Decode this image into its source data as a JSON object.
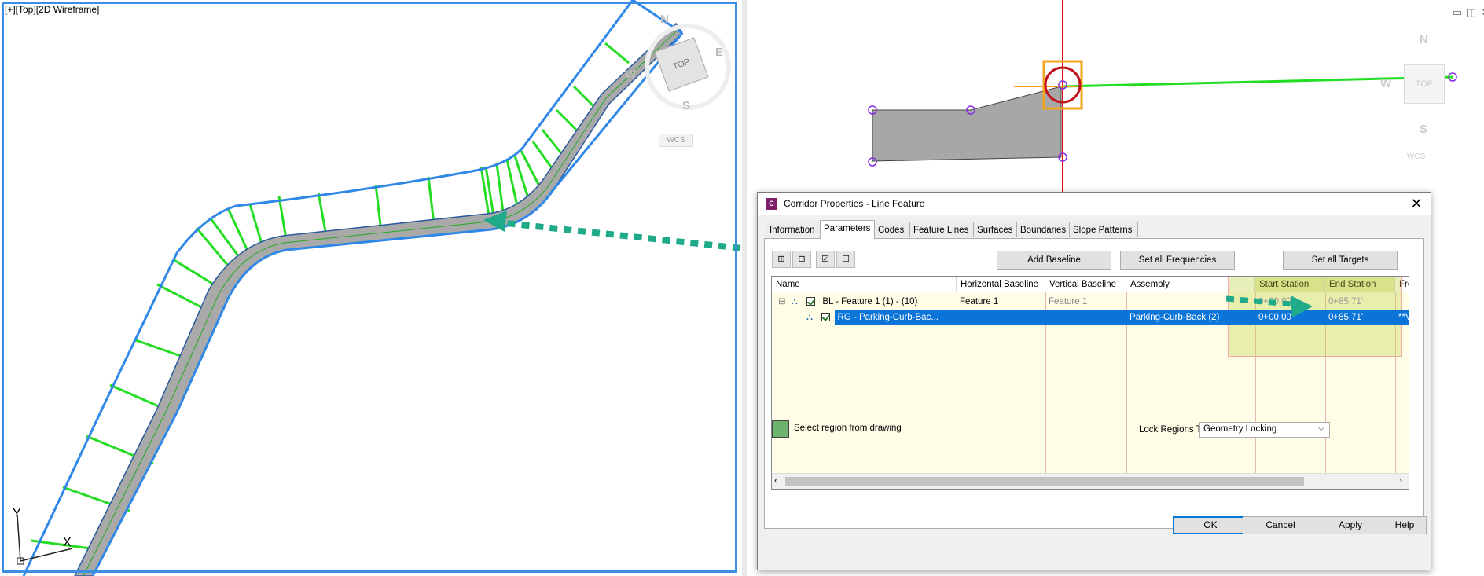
{
  "viewport_left": {
    "label": "[+][Top][2D Wireframe]",
    "viewcube": {
      "top_label": "TOP",
      "north": "N",
      "east": "E",
      "south": "S",
      "west": "W",
      "wcs": "WCS"
    },
    "ucs": {
      "x": "X",
      "y": "Y"
    }
  },
  "viewport_right": {
    "viewcube": {
      "top_label": "TOP",
      "north": "N",
      "south": "S",
      "west": "W",
      "wcs": "WCS"
    },
    "window_controls": {
      "minimize": "▭",
      "restore": "◫",
      "close": "✕"
    }
  },
  "dialog": {
    "icon_letter": "C",
    "title": "Corridor Properties - Line Feature",
    "close": "✕",
    "tabs": [
      {
        "label": "Information",
        "active": false
      },
      {
        "label": "Parameters",
        "active": true
      },
      {
        "label": "Codes",
        "active": false
      },
      {
        "label": "Feature Lines",
        "active": false
      },
      {
        "label": "Surfaces",
        "active": false
      },
      {
        "label": "Boundaries",
        "active": false
      },
      {
        "label": "Slope Patterns",
        "active": false
      }
    ],
    "buttons": {
      "add_baseline": "Add Baseline",
      "set_all_frequencies": "Set all Frequencies",
      "set_all_targets": "Set all Targets"
    },
    "grid": {
      "columns": [
        "Name",
        "Horizontal Baseline",
        "Vertical Baseline",
        "Assembly",
        "Start Station",
        "End Station",
        "Freq"
      ],
      "rows": [
        {
          "expand": "⊟",
          "name": "BL - Feature 1 (1) - (10)",
          "horizontal": "Feature 1",
          "vertical": "Feature 1",
          "assembly": "",
          "start": "0+00.00'",
          "end": "0+85.71'",
          "freq": ""
        },
        {
          "expand": "",
          "name": "RG - Parking-Curb-Bac...",
          "horizontal": "",
          "vertical": "",
          "assembly": "Parking-Curb-Back (2)",
          "start": "0+00.00'",
          "end": "0+85.71'",
          "freq": "**Va"
        }
      ]
    },
    "select_region": "Select region from drawing",
    "lock_regions_label": "Lock Regions To:",
    "lock_regions_value": "Geometry Locking",
    "footer": {
      "ok": "OK",
      "cancel": "Cancel",
      "apply": "Apply",
      "help": "Help"
    }
  }
}
